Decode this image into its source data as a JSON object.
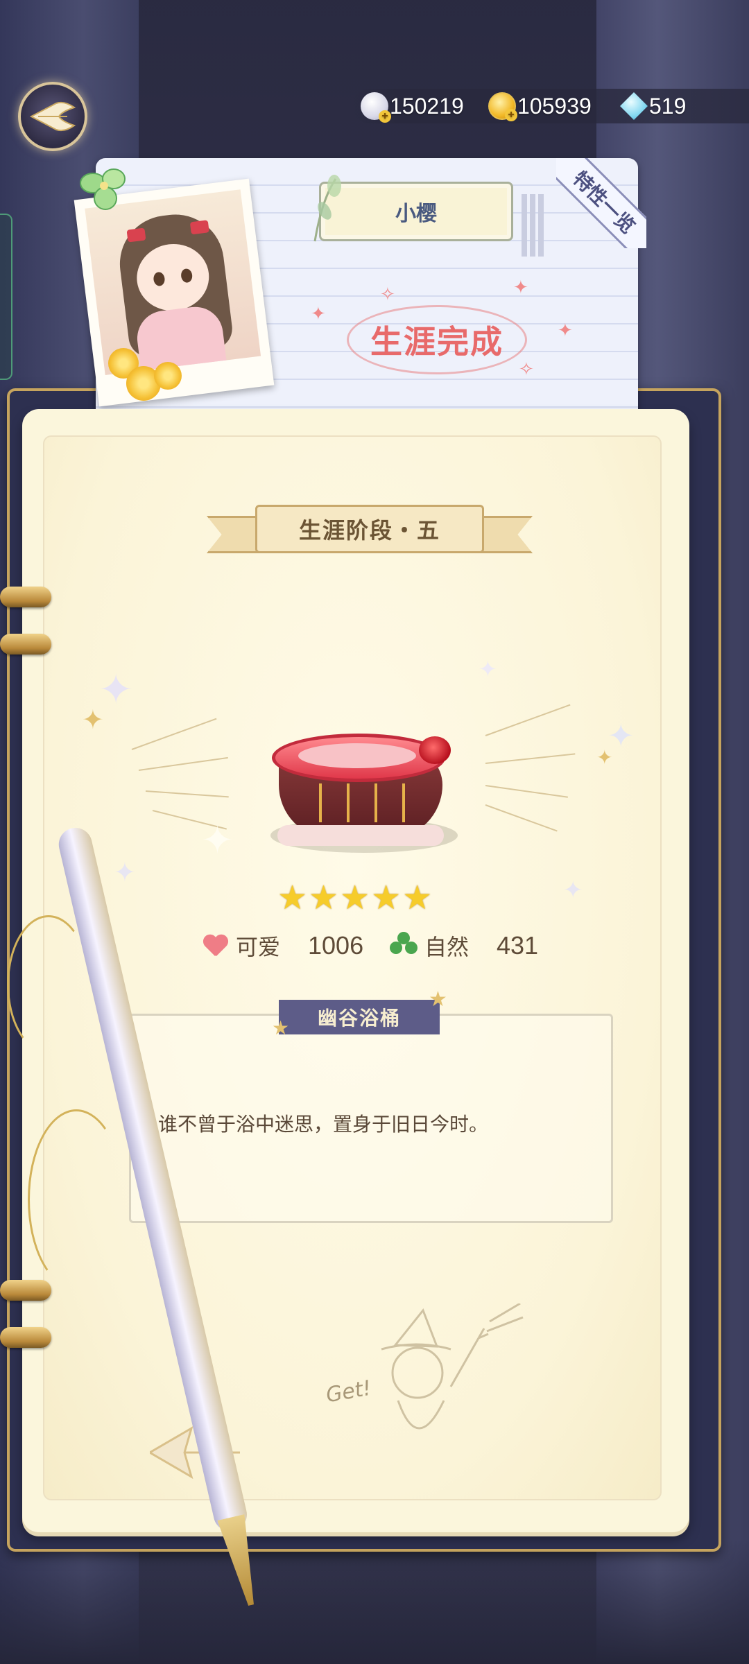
{
  "currencies": [
    {
      "icon": "pearl-icon",
      "value": "150219"
    },
    {
      "icon": "gold-coin-icon",
      "value": "105939"
    },
    {
      "icon": "diamond-icon",
      "value": "519"
    }
  ],
  "profile": {
    "name": "小樱",
    "status_stamp": "生涯完成",
    "traits_tab": "特性一览"
  },
  "career": {
    "stage_title": "生涯阶段・五",
    "item": {
      "stars": 5,
      "name": "幽谷浴桶",
      "description": "谁不曾于浴中迷思，置身于旧日今时。",
      "attributes": [
        {
          "icon": "heart-icon",
          "label": "可爱",
          "value": "1006"
        },
        {
          "icon": "clover-icon",
          "label": "自然",
          "value": "431"
        }
      ]
    }
  },
  "colors": {
    "accent_gold": "#c6a45e",
    "stamp_red": "#e86a6a",
    "name_tag_bg": "#5d5c88",
    "star_yellow": "#f6cc2b"
  }
}
